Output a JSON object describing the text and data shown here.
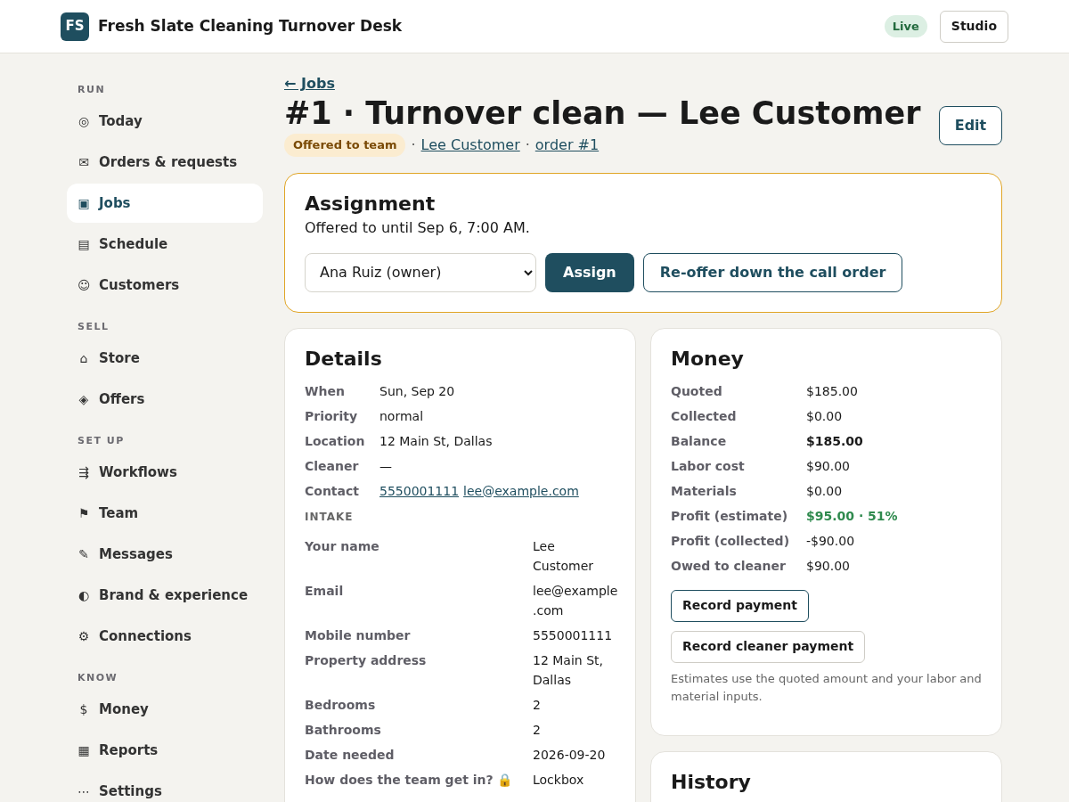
{
  "app": {
    "logo": "FS",
    "title": "Fresh Slate Cleaning Turnover Desk",
    "status_badge": "Live",
    "studio_button": "Studio"
  },
  "sidebar": {
    "sections": [
      {
        "heading": "RUN",
        "items": [
          {
            "icon": "◎",
            "label": "Today",
            "selected": false
          },
          {
            "icon": "✉",
            "label": "Orders & requests",
            "selected": false
          },
          {
            "icon": "▣",
            "label": "Jobs",
            "selected": true
          },
          {
            "icon": "▤",
            "label": "Schedule",
            "selected": false
          },
          {
            "icon": "☺",
            "label": "Customers",
            "selected": false
          }
        ]
      },
      {
        "heading": "SELL",
        "items": [
          {
            "icon": "⌂",
            "label": "Store",
            "selected": false
          },
          {
            "icon": "◈",
            "label": "Offers",
            "selected": false
          }
        ]
      },
      {
        "heading": "SET UP",
        "items": [
          {
            "icon": "⇶",
            "label": "Workflows",
            "selected": false
          },
          {
            "icon": "⚑",
            "label": "Team",
            "selected": false
          },
          {
            "icon": "✎",
            "label": "Messages",
            "selected": false
          },
          {
            "icon": "◐",
            "label": "Brand & experience",
            "selected": false
          },
          {
            "icon": "⚙",
            "label": "Connections",
            "selected": false
          }
        ]
      },
      {
        "heading": "KNOW",
        "items": [
          {
            "icon": "$",
            "label": "Money",
            "selected": false
          },
          {
            "icon": "▦",
            "label": "Reports",
            "selected": false
          },
          {
            "icon": "⋯",
            "label": "Settings",
            "selected": false
          }
        ]
      }
    ]
  },
  "page": {
    "back_link": "← Jobs",
    "title": "#1 · Turnover clean — Lee Customer",
    "status": "Offered to team",
    "separator_1": "·",
    "separator_2": "·",
    "customer_link": "Lee Customer",
    "order_link": "order #1",
    "edit_button": "Edit"
  },
  "assignment": {
    "title": "Assignment",
    "note": "Offered to until Sep 6, 7:00 AM.",
    "cleaner_select": "Ana Ruiz (owner)",
    "assign_button": "Assign",
    "reoffer_button": "Re-offer down the call order"
  },
  "details": {
    "title": "Details",
    "rows": [
      {
        "label": "When",
        "value": "Sun, Sep 20"
      },
      {
        "label": "Priority",
        "value": "normal"
      },
      {
        "label": "Location",
        "value": "12 Main St, Dallas"
      },
      {
        "label": "Cleaner",
        "value": "—"
      },
      {
        "label": "Contact",
        "links": [
          "5550001111",
          "lee@example.com"
        ]
      }
    ],
    "intake_heading": "INTAKE",
    "intake": [
      {
        "label": "Your name",
        "value": "Lee Customer"
      },
      {
        "label": "Email",
        "value": "lee@example.com"
      },
      {
        "label": "Mobile number",
        "value": "5550001111"
      },
      {
        "label": "Property address",
        "value": "12 Main St, Dallas"
      },
      {
        "label": "Bedrooms",
        "value": "2"
      },
      {
        "label": "Bathrooms",
        "value": "2"
      },
      {
        "label": "Date needed",
        "value": "2026-09-20"
      },
      {
        "label": "How does the team get in? 🔒",
        "value": "Lockbox"
      }
    ]
  },
  "money": {
    "title": "Money",
    "rows": [
      {
        "label": "Quoted",
        "value": "$185.00",
        "kind": "plain"
      },
      {
        "label": "Collected",
        "value": "$0.00",
        "kind": "plain"
      },
      {
        "label": "Balance",
        "value": "$185.00",
        "kind": "bold"
      },
      {
        "label": "Labor cost",
        "value": "$90.00",
        "kind": "plain"
      },
      {
        "label": "Materials",
        "value": "$0.00",
        "kind": "plain"
      },
      {
        "label": "Profit (estimate)",
        "value": "$95.00 · 51%",
        "kind": "positive"
      },
      {
        "label": "Profit (collected)",
        "value": "-$90.00",
        "kind": "plain"
      },
      {
        "label": "Owed to cleaner",
        "value": "$90.00",
        "kind": "plain"
      }
    ],
    "record_payment": "Record payment",
    "record_cleaner_payment": "Record cleaner payment",
    "note": "Estimates use the quoted amount and your labor and material inputs."
  },
  "history": {
    "title": "History"
  }
}
